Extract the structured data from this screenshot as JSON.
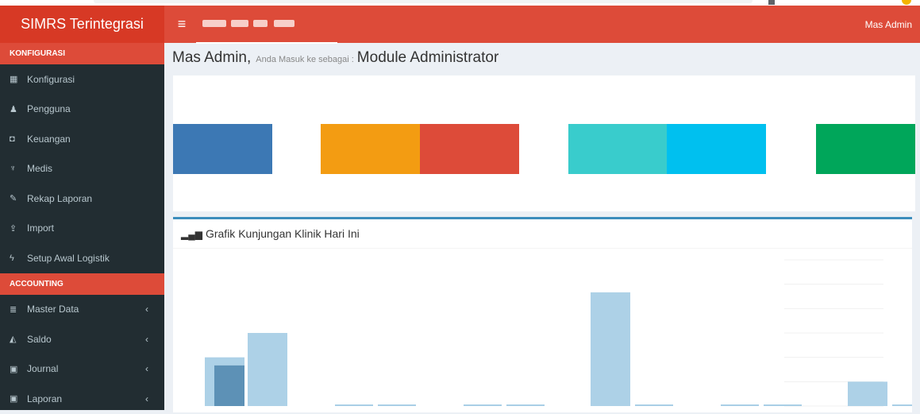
{
  "app": {
    "title": "SIMRS Terintegrasi"
  },
  "header": {
    "user_name": "Mas Admin",
    "toggle_icon": "hamburger-icon"
  },
  "sidebar": {
    "sections": [
      {
        "label": "KONFIGURASI",
        "items": [
          {
            "label": "Konfigurasi",
            "icon": "calendar-icon",
            "glyph": "▦"
          },
          {
            "label": "Pengguna",
            "icon": "user-icon",
            "glyph": "♟"
          },
          {
            "label": "Keuangan",
            "icon": "money-icon",
            "glyph": "◘"
          },
          {
            "label": "Medis",
            "icon": "stethoscope-icon",
            "glyph": "♆"
          },
          {
            "label": "Rekap Laporan",
            "icon": "paperclip-icon",
            "glyph": "✎"
          },
          {
            "label": "Import",
            "icon": "upload-icon",
            "glyph": "⇪"
          },
          {
            "label": "Setup Awal Logistik",
            "icon": "bolt-icon",
            "glyph": "ϟ"
          }
        ]
      },
      {
        "label": "ACCOUNTING",
        "items": [
          {
            "label": "Master Data",
            "icon": "database-icon",
            "glyph": "≣",
            "chevron": "‹"
          },
          {
            "label": "Saldo",
            "icon": "area-chart-icon",
            "glyph": "◭",
            "chevron": "‹"
          },
          {
            "label": "Journal",
            "icon": "excel-file-icon",
            "glyph": "▣",
            "chevron": "‹"
          },
          {
            "label": "Laporan",
            "icon": "excel-file-icon",
            "glyph": "▣",
            "chevron": "‹"
          }
        ]
      }
    ]
  },
  "welcome": {
    "name": "Mas Admin,",
    "text": "Anda Masuk ke sebagai :",
    "module": "Module Administrator"
  },
  "tiles": [
    {
      "name": "tile-blue",
      "color": "#3c78b4"
    },
    {
      "name": "tile-orange",
      "color": "#f39c12"
    },
    {
      "name": "tile-red",
      "color": "#dd4b39"
    },
    {
      "name": "tile-teal",
      "color": "#39cccc"
    },
    {
      "name": "tile-aqua",
      "color": "#00c0ef"
    },
    {
      "name": "tile-green",
      "color": "#00a65a"
    }
  ],
  "chart": {
    "title": "Grafik Kunjungan Klinik Hari Ini",
    "icon": "bar-chart-icon"
  },
  "chart_data": {
    "type": "bar",
    "title": "Grafik Kunjungan Klinik Hari Ini",
    "xlabel": "",
    "ylabel": "",
    "series": [
      {
        "values": [
          30,
          45,
          0,
          0,
          0,
          0,
          70,
          0,
          0,
          0,
          15,
          0,
          0,
          0
        ],
        "color": "#a9cfe6"
      },
      {
        "values": [
          25,
          0,
          0,
          0,
          0,
          0,
          0,
          0,
          0,
          0,
          0,
          0,
          0,
          0
        ],
        "color": "#4f86ad"
      }
    ],
    "ylim": [
      0,
      90
    ],
    "grid": true
  }
}
